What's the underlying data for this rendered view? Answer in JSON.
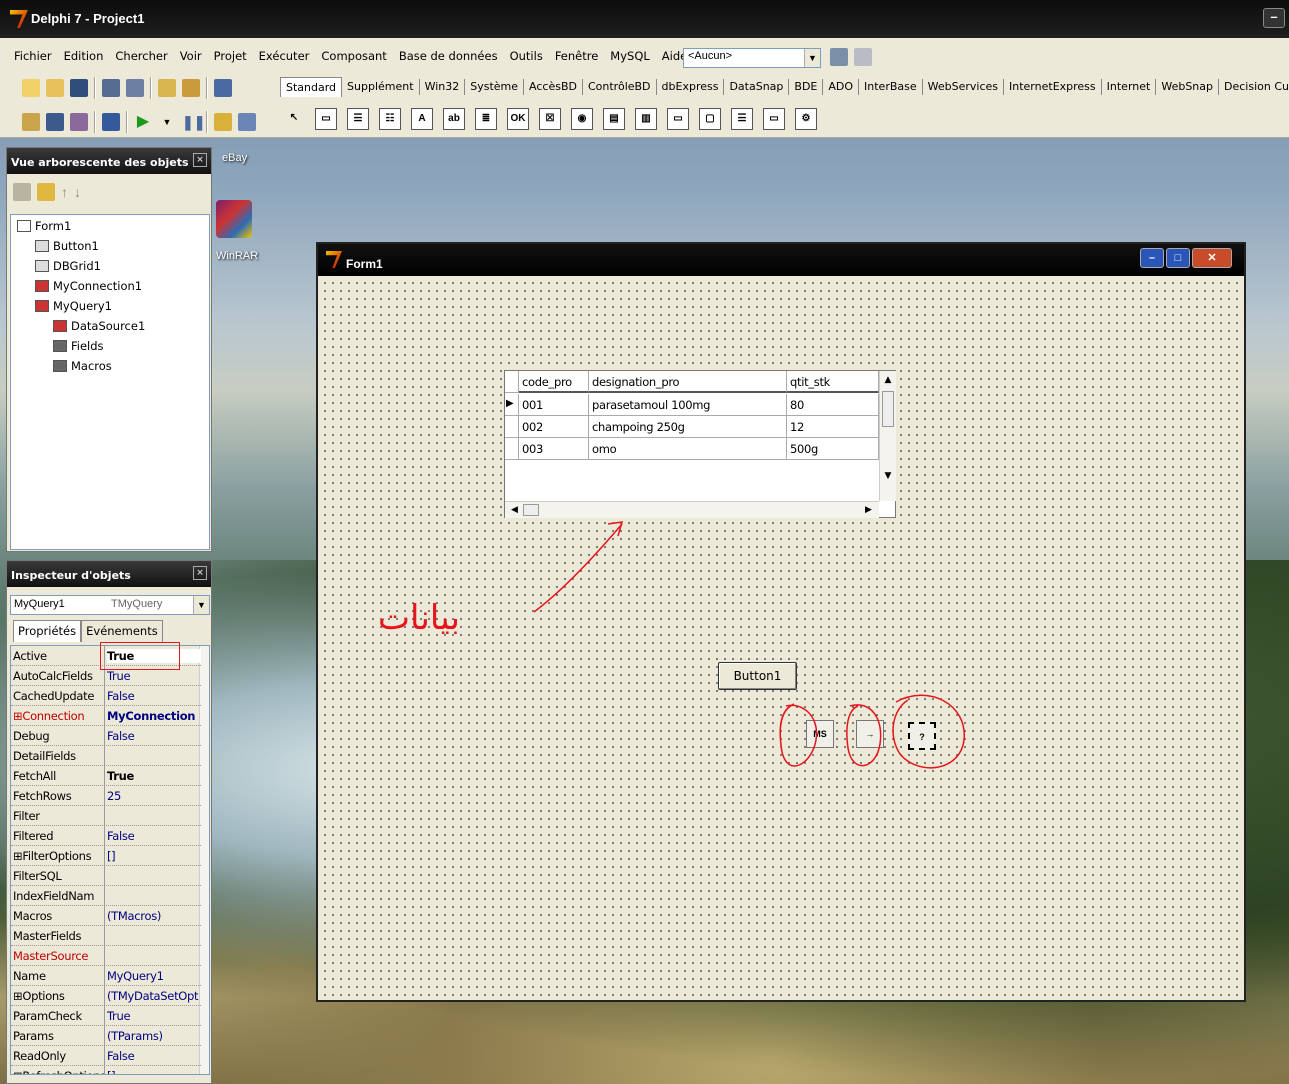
{
  "window": {
    "title": "Delphi 7 - Project1"
  },
  "menu": [
    "Fichier",
    "Edition",
    "Chercher",
    "Voir",
    "Projet",
    "Exécuter",
    "Composant",
    "Base de données",
    "Outils",
    "Fenêtre",
    "MySQL",
    "Aide"
  ],
  "config_combo": "<Aucun>",
  "palette_tabs": [
    "Standard",
    "Supplément",
    "Win32",
    "Système",
    "AccèsBD",
    "ContrôleBD",
    "dbExpress",
    "DataSnap",
    "BDE",
    "ADO",
    "InterBase",
    "WebServices",
    "InternetExpress",
    "Internet",
    "WebSnap",
    "Decision Cube"
  ],
  "palette_icons": [
    "pointer-icon",
    "frames-icon",
    "mainmenu-icon",
    "popupmenu-icon",
    "label-icon",
    "edit-icon",
    "memo-icon",
    "button-icon",
    "checkbox-icon",
    "radiobutton-icon",
    "listbox-icon",
    "combobox-icon",
    "scrollbar-icon",
    "groupbox-icon",
    "radiogroup-icon",
    "panel-icon",
    "actionlist-icon"
  ],
  "desktop": {
    "ebay_label": "eBay",
    "winrar_label": "WinRAR"
  },
  "tree_panel": {
    "title": "Vue arborescente des objets",
    "nodes": [
      {
        "label": "Form1",
        "indent": 0
      },
      {
        "label": "Button1",
        "indent": 1
      },
      {
        "label": "DBGrid1",
        "indent": 1
      },
      {
        "label": "MyConnection1",
        "indent": 1
      },
      {
        "label": "MyQuery1",
        "indent": 1
      },
      {
        "label": "DataSource1",
        "indent": 2
      },
      {
        "label": "Fields",
        "indent": 2
      },
      {
        "label": "Macros",
        "indent": 2
      }
    ]
  },
  "inspector": {
    "title": "Inspecteur d'objets",
    "object_name": "MyQuery1",
    "object_type": "TMyQuery",
    "tab_props": "Propriétés",
    "tab_events": "Evénements",
    "rows": [
      {
        "name": "Active",
        "value": "True"
      },
      {
        "name": "AutoCalcFields",
        "value": "True"
      },
      {
        "name": "CachedUpdate",
        "value": "False"
      },
      {
        "name": "⊞Connection",
        "value": "MyConnection"
      },
      {
        "name": "Debug",
        "value": "False"
      },
      {
        "name": "DetailFields",
        "value": ""
      },
      {
        "name": "FetchAll",
        "value": "True"
      },
      {
        "name": "FetchRows",
        "value": "25"
      },
      {
        "name": "Filter",
        "value": ""
      },
      {
        "name": "Filtered",
        "value": "False"
      },
      {
        "name": "⊞FilterOptions",
        "value": "[]"
      },
      {
        "name": "FilterSQL",
        "value": ""
      },
      {
        "name": "IndexFieldNam",
        "value": ""
      },
      {
        "name": "Macros",
        "value": "(TMacros)"
      },
      {
        "name": "MasterFields",
        "value": ""
      },
      {
        "name": "MasterSource",
        "value": ""
      },
      {
        "name": "Name",
        "value": "MyQuery1"
      },
      {
        "name": "⊞Options",
        "value": "(TMyDataSetOpt"
      },
      {
        "name": "ParamCheck",
        "value": "True"
      },
      {
        "name": "Params",
        "value": "(TParams)"
      },
      {
        "name": "ReadOnly",
        "value": "False"
      },
      {
        "name": "⊞RefreshOptions",
        "value": "[]"
      }
    ]
  },
  "form": {
    "title": "Form1",
    "grid": {
      "columns": [
        "code_pro",
        "designation_pro",
        "qtit_stk"
      ],
      "rows": [
        [
          "001",
          "parasetamoul 100mg",
          "80"
        ],
        [
          "002",
          "champoing 250g",
          "12"
        ],
        [
          "003",
          "omo",
          "500g"
        ]
      ]
    },
    "button_label": "Button1",
    "components": [
      {
        "name": "myconnection-component-icon"
      },
      {
        "name": "datasource-component-icon"
      },
      {
        "name": "myquery-component-icon"
      }
    ],
    "annotation_text": "بيانات"
  },
  "colors": {
    "annotation": "#e8141b",
    "link_blue": "#000080"
  }
}
